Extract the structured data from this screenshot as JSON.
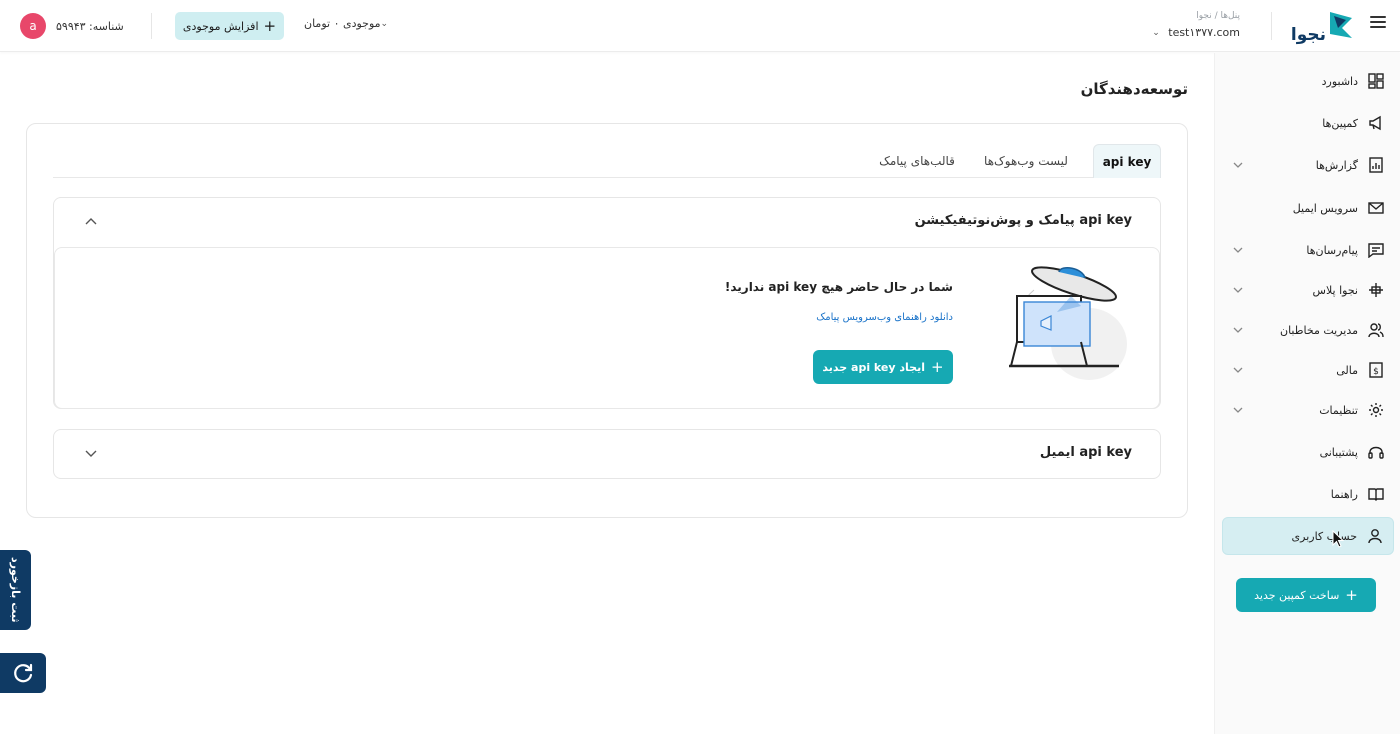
{
  "header": {
    "breadcrumb": "پنل‌ها / نجوا",
    "panel_name": "test۱۳۷۷.com",
    "logo_text": "نجوا",
    "balance_label": "موجودی ۰ تومان",
    "increase_label": "افزایش موجودی",
    "user_id_label": "شناسه: ۵۹۹۴۳",
    "avatar_letter": "a"
  },
  "sidebar": {
    "items": [
      {
        "label": "داشبورد",
        "icon": "dashboard-icon",
        "has_chevron": false
      },
      {
        "label": "کمپین‌ها",
        "icon": "megaphone-icon",
        "has_chevron": false
      },
      {
        "label": "گزارش‌ها",
        "icon": "report-icon",
        "has_chevron": true
      },
      {
        "label": "سرویس ایمیل",
        "icon": "mail-icon",
        "has_chevron": false
      },
      {
        "label": "پیام‌رسان‌ها",
        "icon": "chat-icon",
        "has_chevron": true
      },
      {
        "label": "نجوا پلاس",
        "icon": "plus-logo-icon",
        "has_chevron": true
      },
      {
        "label": "مدیریت مخاطبان",
        "icon": "users-icon",
        "has_chevron": true
      },
      {
        "label": "مالی",
        "icon": "finance-icon",
        "has_chevron": true
      },
      {
        "label": "تنظیمات",
        "icon": "gear-icon",
        "has_chevron": true
      },
      {
        "label": "پشتیبانی",
        "icon": "headset-icon",
        "has_chevron": false
      },
      {
        "label": "راهنما",
        "icon": "book-icon",
        "has_chevron": false
      },
      {
        "label": "حساب کاربری",
        "icon": "user-icon",
        "has_chevron": false,
        "active": true
      }
    ],
    "new_campaign_label": "ساخت کمپین جدید"
  },
  "main": {
    "page_title": "توسعه‌دهندگان",
    "tabs": [
      {
        "label": "api key",
        "active": true
      },
      {
        "label": "لیست وب‌هوک‌ها",
        "active": false
      },
      {
        "label": "قالب‌های پیامک",
        "active": false
      }
    ],
    "sms_section": {
      "title": "api key پیامک و پوش‌نوتیفیکیشن",
      "empty_message": "شما در حال حاضر هیچ api key ندارید!",
      "doc_link": "دانلود راهنمای وب‌سرویس پیامک",
      "create_button": "ایجاد api key جدید"
    },
    "email_section": {
      "title": "api key ایمیل"
    }
  },
  "floating": {
    "feedback_label": "ثبت بازخورد"
  },
  "colors": {
    "accent": "#16a9b3",
    "accent_light": "#cfeef1",
    "avatar": "#e8476a",
    "navy": "#0f3a64",
    "link": "#1a73c9"
  }
}
